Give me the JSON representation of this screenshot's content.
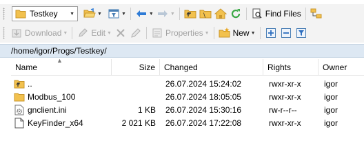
{
  "toolbar1": {
    "drive_combo": "Testkey",
    "find_files": "Find Files"
  },
  "toolbar2": {
    "download": "Download",
    "edit": "Edit",
    "properties": "Properties",
    "new": "New"
  },
  "path": "/home/igor/Progs/Testkey/",
  "columns": {
    "name": "Name",
    "size": "Size",
    "changed": "Changed",
    "rights": "Rights",
    "owner": "Owner"
  },
  "files": [
    {
      "name": "..",
      "size": "",
      "changed": "26.07.2024 15:24:02",
      "rights": "rwxr-xr-x",
      "owner": "igor",
      "icon": "parent-folder-icon"
    },
    {
      "name": "Modbus_100",
      "size": "",
      "changed": "26.07.2024 18:05:05",
      "rights": "rwxr-xr-x",
      "owner": "igor",
      "icon": "folder-icon"
    },
    {
      "name": "gnclient.ini",
      "size": "1 KB",
      "changed": "26.07.2024 15:30:16",
      "rights": "rw-r--r--",
      "owner": "igor",
      "icon": "settings-file-icon"
    },
    {
      "name": "KeyFinder_x64",
      "size": "2 021 KB",
      "changed": "26.07.2024 17:22:08",
      "rights": "rwxr-xr-x",
      "owner": "igor",
      "icon": "file-icon"
    }
  ],
  "colors": {
    "folder": "#f2c14e",
    "accent_blue": "#2e7bd6",
    "refresh_green": "#3aa845",
    "pathbar_bg": "#dde8f3"
  }
}
